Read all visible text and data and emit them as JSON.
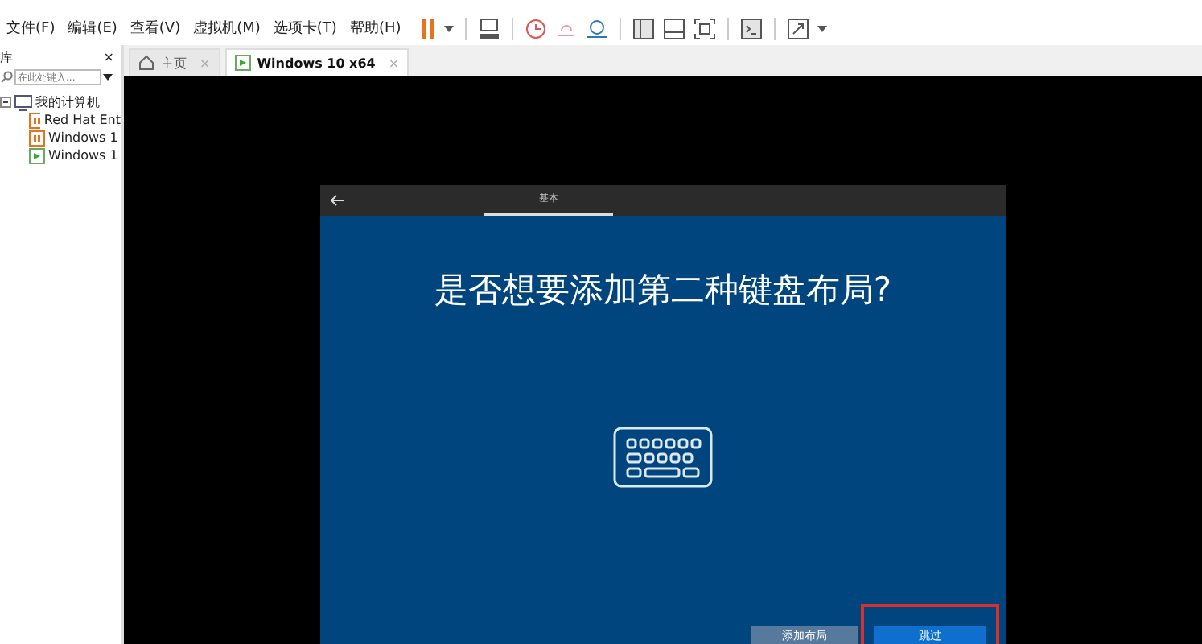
{
  "menu": [
    "文件(F)",
    "编辑(E)",
    "查看(V)",
    "虚拟机(M)",
    "选项卡(T)",
    "帮助(H)"
  ],
  "sidebar": {
    "title": "库",
    "close": "×",
    "search": {
      "placeholder": "在此处键入..."
    },
    "tree": [
      {
        "label": "我的计算机",
        "expanded": true,
        "children": [
          {
            "label": "Red Hat Ent",
            "kind": "vm-off"
          },
          {
            "label": "Windows 1",
            "kind": "vm-off"
          },
          {
            "label": "Windows 1",
            "kind": "vm-on"
          }
        ]
      }
    ]
  },
  "tabs": [
    {
      "label": "主页",
      "kind": "home",
      "selected": false,
      "close": "×"
    },
    {
      "label": "Windows 10 x64",
      "kind": "vm",
      "selected": true,
      "close": "×"
    }
  ],
  "setup": {
    "header_tab": "基本",
    "heading": "是否想要添加第二种键盘布局?",
    "buttons": [
      {
        "label": "添加布局",
        "kind": "secondary",
        "highlighted": false
      },
      {
        "label": "跳过",
        "kind": "primary",
        "highlighted": true
      }
    ]
  }
}
